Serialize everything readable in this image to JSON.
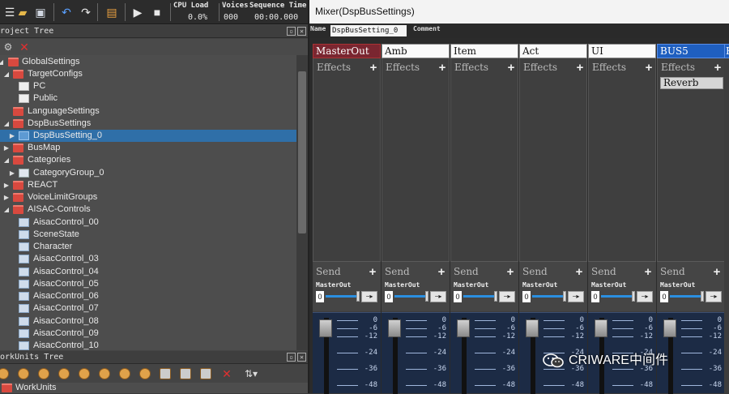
{
  "toolbar": {
    "cpu_label": "CPU Load",
    "cpu_value": "0.0%",
    "voices_label": "Voices",
    "voices_value": "000",
    "seqtime_label": "Sequence Time",
    "seqtime_value": "00:00.000"
  },
  "project_tree": {
    "title": "Project Tree",
    "items": [
      {
        "label": "GlobalSettings",
        "type": "folder",
        "expanded": true
      },
      {
        "label": "TargetConfigs",
        "type": "folder",
        "expanded": true
      },
      {
        "label": "PC",
        "type": "config"
      },
      {
        "label": "Public",
        "type": "config"
      },
      {
        "label": "LanguageSettings",
        "type": "folder"
      },
      {
        "label": "DspBusSettings",
        "type": "folder",
        "expanded": true
      },
      {
        "label": "DspBusSetting_0",
        "type": "bus",
        "selected": true
      },
      {
        "label": "BusMap",
        "type": "folder"
      },
      {
        "label": "Categories",
        "type": "folder",
        "expanded": true
      },
      {
        "label": "CategoryGroup_0",
        "type": "category-group"
      },
      {
        "label": "REACT",
        "type": "folder"
      },
      {
        "label": "VoiceLimitGroups",
        "type": "folder"
      },
      {
        "label": "AISAC-Controls",
        "type": "folder",
        "expanded": true
      },
      {
        "label": "AisacControl_00",
        "type": "aisac"
      },
      {
        "label": "SceneState",
        "type": "aisac"
      },
      {
        "label": "Character",
        "type": "aisac"
      },
      {
        "label": "AisacControl_03",
        "type": "aisac"
      },
      {
        "label": "AisacControl_04",
        "type": "aisac"
      },
      {
        "label": "AisacControl_05",
        "type": "aisac"
      },
      {
        "label": "AisacControl_06",
        "type": "aisac"
      },
      {
        "label": "AisacControl_07",
        "type": "aisac"
      },
      {
        "label": "AisacControl_08",
        "type": "aisac"
      },
      {
        "label": "AisacControl_09",
        "type": "aisac"
      },
      {
        "label": "AisacControl_10",
        "type": "aisac"
      }
    ]
  },
  "workunits_tree": {
    "title": "WorkUnits Tree",
    "root_label": "WorkUnits"
  },
  "mixer": {
    "title": "Mixer(DspBusSettings)",
    "name_label": "Name",
    "name_value": "DspBusSetting_0",
    "comment_label": "Comment",
    "effects_label": "Effects",
    "send_label": "Send",
    "send_destination": "MasterOut",
    "send_value": "0",
    "buses": [
      {
        "name": "MasterOut",
        "effects": []
      },
      {
        "name": "Amb",
        "effects": []
      },
      {
        "name": "Item",
        "effects": []
      },
      {
        "name": "Act",
        "effects": []
      },
      {
        "name": "UI",
        "effects": []
      },
      {
        "name": "BUS5",
        "effects": [
          "Reverb"
        ]
      }
    ],
    "meter_ticks": [
      "0",
      "-6",
      "-12",
      "-24",
      "-36",
      "-48"
    ],
    "next_bus_partial": "B"
  },
  "watermark": {
    "text": "CRIWARE中间件"
  }
}
